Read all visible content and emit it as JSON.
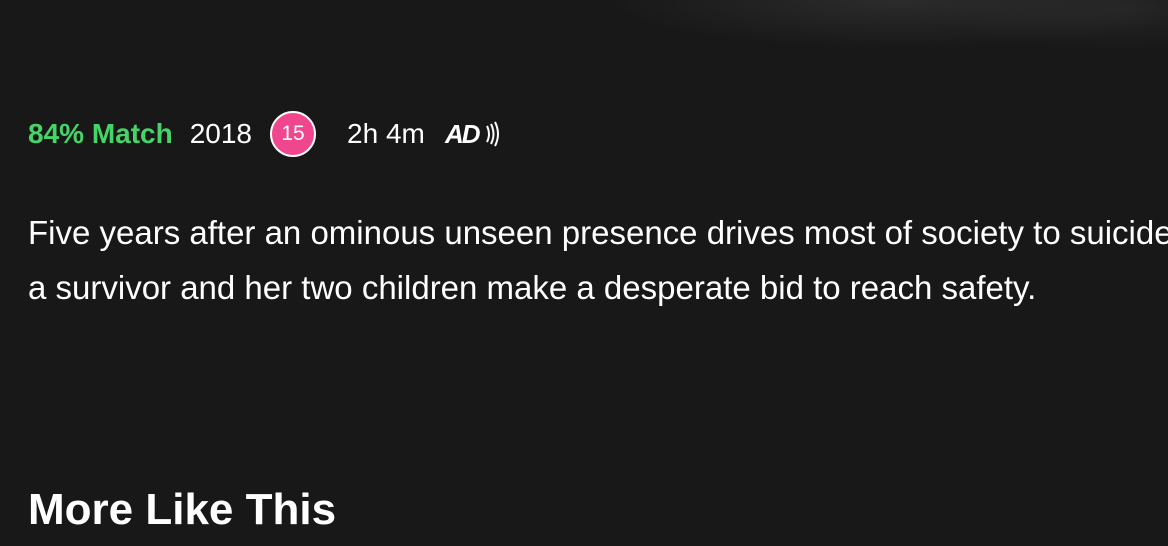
{
  "title_info": {
    "match": "84% Match",
    "year": "2018",
    "maturity_rating": "15",
    "duration": "2h 4m",
    "audio_description_icon": "audio-description-icon"
  },
  "description": "Five years after an ominous unseen presence drives most of society to suicide, a survivor and her two children make a desperate bid to reach safety.",
  "more_like_this": {
    "heading": "More Like This"
  },
  "colors": {
    "background": "#181818",
    "match": "#46d369",
    "rating_badge": "#f0468e",
    "text": "#ffffff"
  }
}
